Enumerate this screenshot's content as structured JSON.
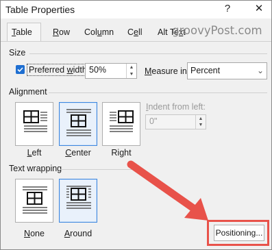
{
  "window": {
    "title": "Table Properties",
    "help_glyph": "?",
    "close_glyph": "✕"
  },
  "watermark": "groovyPost.com",
  "tabs": [
    {
      "label": "Table",
      "active": true
    },
    {
      "label": "Row",
      "active": false
    },
    {
      "label": "Column",
      "active": false
    },
    {
      "label": "Cell",
      "active": false
    },
    {
      "label": "Alt Text",
      "active": false
    }
  ],
  "size": {
    "section_label": "Size",
    "preferred_width_label": "Preferred width:",
    "preferred_width_checked": true,
    "width_value": "50%",
    "measure_label": "Measure in:",
    "measure_value": "Percent"
  },
  "alignment": {
    "section_label": "Alignment",
    "options": [
      {
        "label": "Left",
        "selected": false
      },
      {
        "label": "Center",
        "selected": true
      },
      {
        "label": "Right",
        "selected": false
      }
    ],
    "indent_label": "Indent from left:",
    "indent_value": "0\""
  },
  "text_wrapping": {
    "section_label": "Text wrapping",
    "options": [
      {
        "label": "None",
        "selected": false
      },
      {
        "label": "Around",
        "selected": true
      }
    ]
  },
  "positioning_button": "Positioning...",
  "colors": {
    "accent": "#1f6fd1",
    "highlight": "#e8524a",
    "selected_tile_border": "#3b86e0"
  },
  "icons": [
    "help-icon",
    "close-icon",
    "checkbox-checked-icon",
    "spin-up-icon",
    "spin-down-icon",
    "chevron-down-icon",
    "table-left-icon",
    "table-center-icon",
    "table-right-icon",
    "wrap-none-icon",
    "wrap-around-icon",
    "red-arrow-annotation"
  ]
}
